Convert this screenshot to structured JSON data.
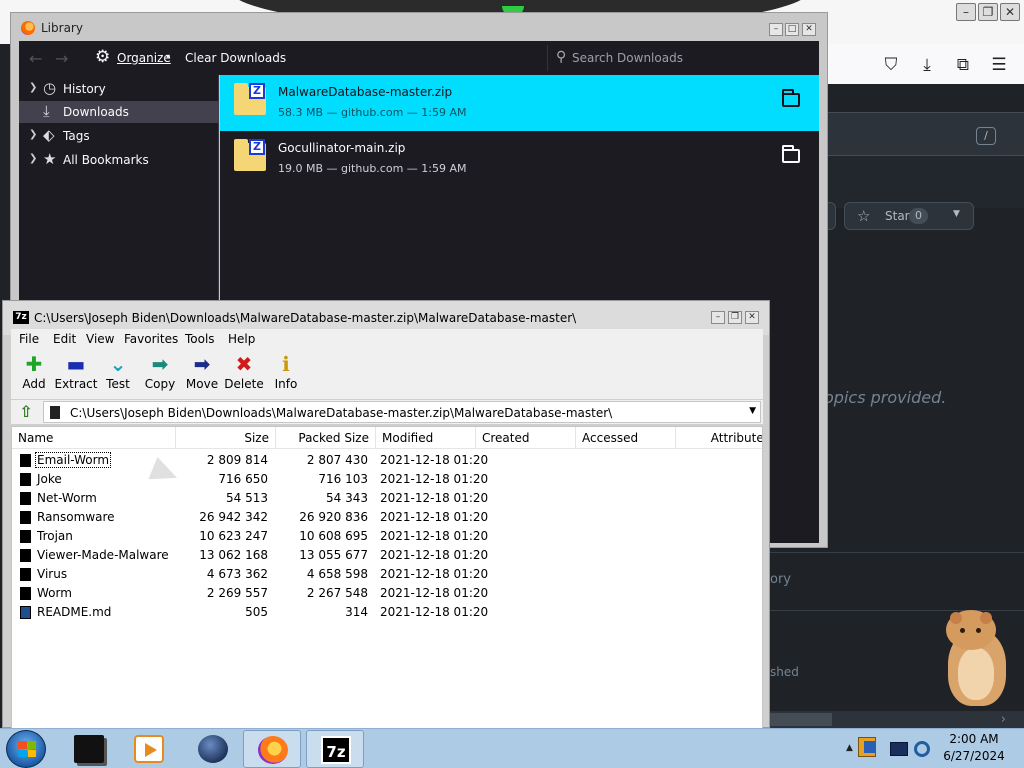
{
  "browser": {
    "search_shortcut": "/",
    "star": {
      "label": "Star",
      "count": "0"
    },
    "about_text": "te, or topics provided.",
    "history_text": "ory",
    "published_text": "shed"
  },
  "library": {
    "title": "Library",
    "toolbar": {
      "organize_label": "Organize",
      "clear_label": "Clear Downloads",
      "search_placeholder": "Search Downloads"
    },
    "sidebar": {
      "items": [
        {
          "label": "History"
        },
        {
          "label": "Downloads"
        },
        {
          "label": "Tags"
        },
        {
          "label": "All Bookmarks"
        }
      ]
    },
    "downloads": [
      {
        "name": "MalwareDatabase-master.zip",
        "meta": "58.3 MB — github.com — 1:59 AM"
      },
      {
        "name": "Gocullinator-main.zip",
        "meta": "19.0 MB — github.com — 1:59 AM"
      }
    ]
  },
  "sevenzip": {
    "app_icon_text": "7z",
    "title": "C:\\Users\\Joseph Biden\\Downloads\\MalwareDatabase-master.zip\\MalwareDatabase-master\\",
    "menu": [
      "File",
      "Edit",
      "View",
      "Favorites",
      "Tools",
      "Help"
    ],
    "toolbar": [
      {
        "label": "Add"
      },
      {
        "label": "Extract"
      },
      {
        "label": "Test"
      },
      {
        "label": "Copy"
      },
      {
        "label": "Move"
      },
      {
        "label": "Delete"
      },
      {
        "label": "Info"
      }
    ],
    "address": "C:\\Users\\Joseph Biden\\Downloads\\MalwareDatabase-master.zip\\MalwareDatabase-master\\",
    "columns": [
      "Name",
      "Size",
      "Packed Size",
      "Modified",
      "Created",
      "Accessed",
      "Attributes"
    ],
    "rows": [
      {
        "name": "Email-Worm",
        "size": "2 809 814",
        "packed": "2 807 430",
        "modified": "2021-12-18 01:20"
      },
      {
        "name": "Joke",
        "size": "716 650",
        "packed": "716 103",
        "modified": "2021-12-18 01:20"
      },
      {
        "name": "Net-Worm",
        "size": "54 513",
        "packed": "54 343",
        "modified": "2021-12-18 01:20"
      },
      {
        "name": "Ransomware",
        "size": "26 942 342",
        "packed": "26 920 836",
        "modified": "2021-12-18 01:20"
      },
      {
        "name": "Trojan",
        "size": "10 623 247",
        "packed": "10 608 695",
        "modified": "2021-12-18 01:20"
      },
      {
        "name": "Viewer-Made-Malware",
        "size": "13 062 168",
        "packed": "13 055 677",
        "modified": "2021-12-18 01:20"
      },
      {
        "name": "Virus",
        "size": "4 673 362",
        "packed": "4 658 598",
        "modified": "2021-12-18 01:20"
      },
      {
        "name": "Worm",
        "size": "2 269 557",
        "packed": "2 267 548",
        "modified": "2021-12-18 01:20"
      },
      {
        "name": "README.md",
        "size": "505",
        "packed": "314",
        "modified": "2021-12-18 01:20"
      }
    ]
  },
  "taskbar": {
    "sevenzip_icon_text": "7z",
    "clock": {
      "time": "2:00 AM",
      "date": "6/27/2024"
    }
  }
}
